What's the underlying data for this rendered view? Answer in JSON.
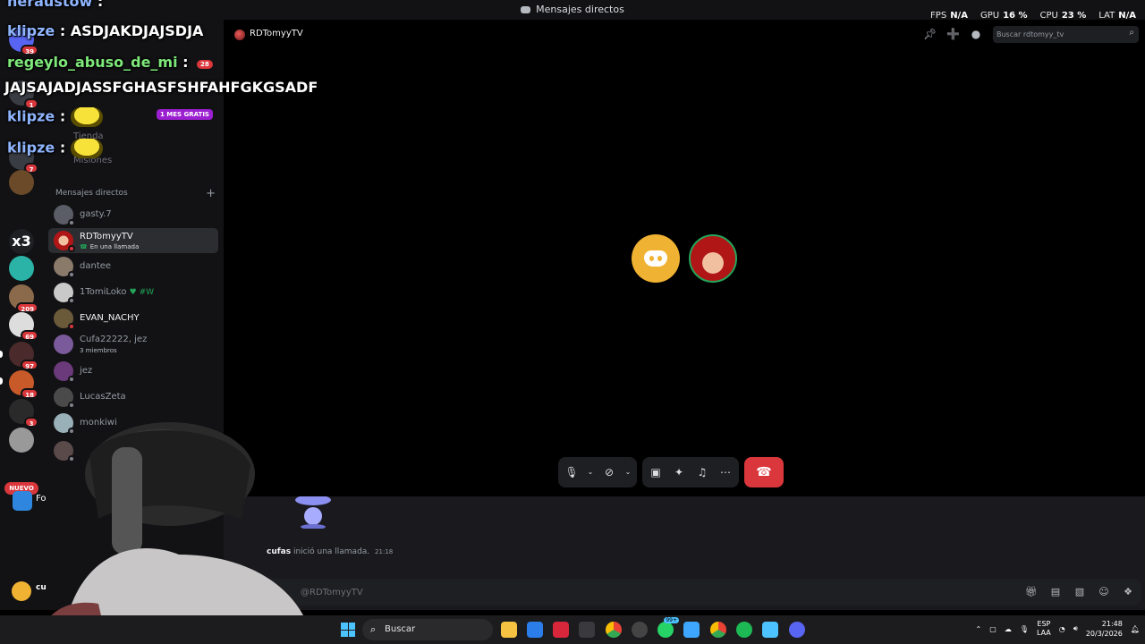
{
  "window": {
    "title": "Mensajes directos"
  },
  "stats": [
    {
      "key": "FPS",
      "value": "N/A"
    },
    {
      "key": "GPU",
      "value": "16 %"
    },
    {
      "key": "CPU",
      "value": "23 %"
    },
    {
      "key": "LAT",
      "value": "N/A"
    }
  ],
  "overlay": {
    "lines": [
      {
        "user": "heraustow",
        "msg": ":"
      },
      {
        "user": "klipze",
        "msg": ": ASDJAKDJAJSDJA"
      },
      {
        "user": "regeylo_abuso_de_mi",
        "msg": ":"
      },
      {
        "user": "",
        "msg": "JAJSAJADJASSFGHASFSHFAHFGKGSADF"
      },
      {
        "user": "klipze",
        "msg": ":"
      },
      {
        "user": "klipze",
        "msg": ":"
      }
    ],
    "badge_28": "28"
  },
  "rail": {
    "badges": [
      "39",
      "1",
      "7",
      "209",
      "69",
      "97",
      "18",
      "3"
    ],
    "nuevo": "NUEVO",
    "folder_label": "x3"
  },
  "sidebar": {
    "promo": "1 MES GRATIS",
    "nav": [
      "Tienda",
      "Misiones"
    ],
    "dm_header": "Mensajes directos",
    "dms": [
      {
        "name": "gasty.7",
        "sub": ""
      },
      {
        "name": "RDTomyyTV",
        "sub": "En una llamada"
      },
      {
        "name": "dantee",
        "sub": ""
      },
      {
        "name": "1TomiLoko",
        "sub": "",
        "tag": "♥ #W"
      },
      {
        "name": "EVAN_NACHY",
        "sub": ""
      },
      {
        "name": "Cufa22222, jez",
        "sub": "3 miembros"
      },
      {
        "name": "jez",
        "sub": ""
      },
      {
        "name": "LucasZeta",
        "sub": ""
      },
      {
        "name": "monkiwi",
        "sub": ""
      }
    ],
    "user_short": "cu",
    "activity_short": "Fo"
  },
  "header": {
    "channel": "RDTomyyTV",
    "search_placeholder": "Buscar rdtomyy_tv"
  },
  "chat": {
    "system_user": "cufas",
    "system_text": "inició una llamada.",
    "system_time": "21:18",
    "composer_placeholder": "@RDTomyyTV"
  },
  "taskbar": {
    "search": "Buscar",
    "lang1": "ESP",
    "lang2": "LAA",
    "time": "21:48",
    "date": "20/3/2026",
    "whatsapp_count": "99+"
  },
  "colors": {
    "accent_red": "#da373c",
    "online_green": "#23a55a",
    "discord_yellow": "#f0b232"
  }
}
